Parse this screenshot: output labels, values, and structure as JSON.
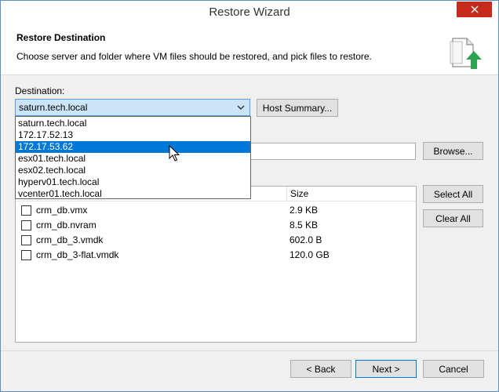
{
  "window": {
    "title": "Restore Wizard"
  },
  "header": {
    "title": "Restore Destination",
    "description": "Choose server and folder where VM files should be restored, and pick files to restore."
  },
  "destination": {
    "label": "Destination:",
    "selected": "saturn.tech.local",
    "host_summary_label": "Host Summary...",
    "options": [
      "saturn.tech.local",
      "172.17.52.13",
      "172.17.53.62",
      "esx01.tech.local",
      "esx02.tech.local",
      "hyperv01.tech.local",
      "vcenter01.tech.local"
    ],
    "highlighted_option": "172.17.53.62"
  },
  "path": {
    "value": "",
    "browse_label": "Browse..."
  },
  "files": {
    "columns": {
      "name": "",
      "size": "Size"
    },
    "rows": [
      {
        "name": "crm_db.vmx",
        "size": "2.9 KB",
        "checked": false
      },
      {
        "name": "crm_db.nvram",
        "size": "8.5 KB",
        "checked": false
      },
      {
        "name": "crm_db_3.vmdk",
        "size": "602.0 B",
        "checked": false
      },
      {
        "name": "crm_db_3-flat.vmdk",
        "size": "120.0 GB",
        "checked": false
      }
    ],
    "select_all_label": "Select All",
    "clear_all_label": "Clear All"
  },
  "footer": {
    "back_label": "< Back",
    "next_label": "Next >",
    "cancel_label": "Cancel"
  },
  "icons": {
    "close": "close-icon",
    "restore": "restore-files-icon",
    "dropdown": "chevron-down-icon",
    "cursor": "mouse-pointer-icon"
  },
  "colors": {
    "accent": "#0078d7",
    "close": "#c42b1c",
    "icon_green": "#2da44e"
  }
}
